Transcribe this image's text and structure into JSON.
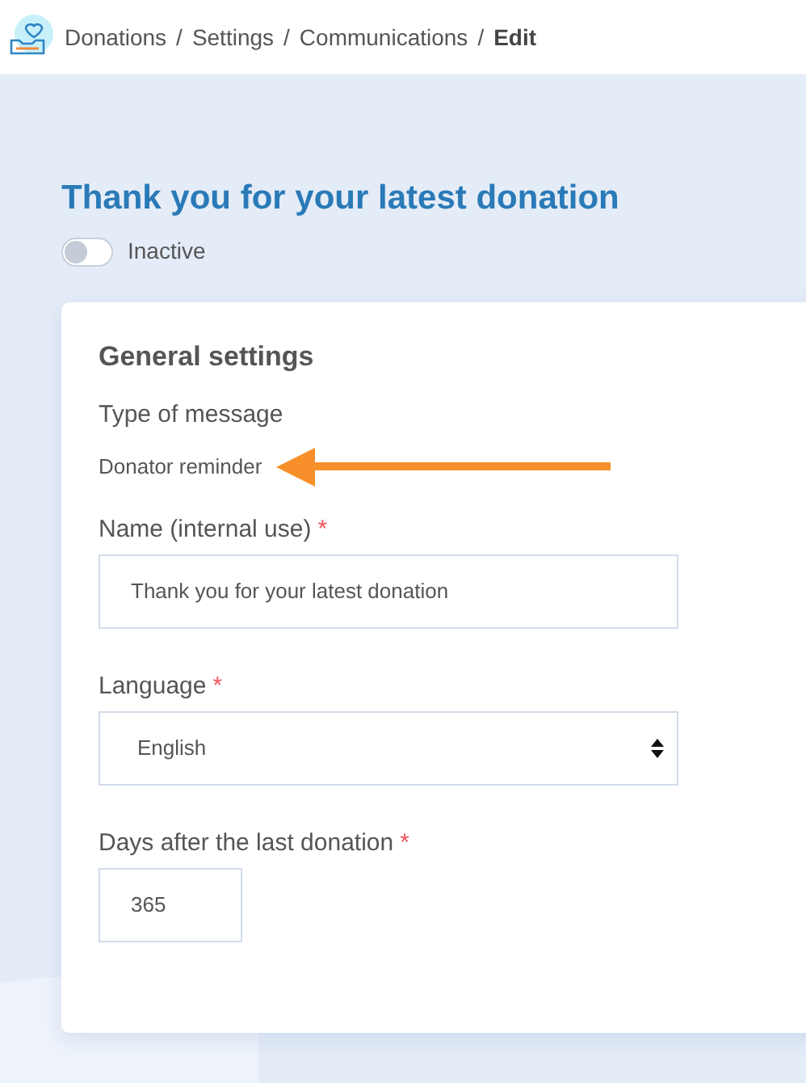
{
  "breadcrumb": {
    "items": [
      {
        "label": "Donations",
        "current": false
      },
      {
        "label": "Settings",
        "current": false
      },
      {
        "label": "Communications",
        "current": false
      },
      {
        "label": "Edit",
        "current": true
      }
    ],
    "separators": [
      "/",
      "/",
      "/"
    ]
  },
  "title": "Thank you for your latest donation",
  "status_toggle": {
    "on": false,
    "label": "Inactive"
  },
  "card": {
    "heading": "General settings",
    "type_of_message": {
      "label": "Type of message",
      "value": "Donator reminder"
    },
    "fields": [
      {
        "kind": "text",
        "label": "Name (internal use)",
        "required_mark": "*",
        "value": "Thank you for your latest donation"
      },
      {
        "kind": "select",
        "label": "Language",
        "required_mark": "*",
        "value": "English"
      },
      {
        "kind": "number",
        "label": "Days after the last donation",
        "required_mark": "*",
        "value": "365"
      }
    ]
  }
}
